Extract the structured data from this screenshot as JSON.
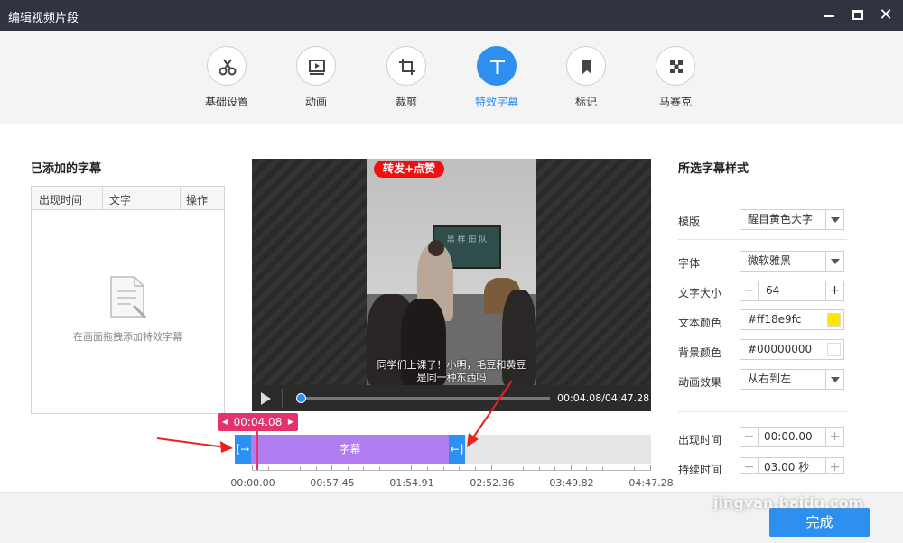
{
  "window": {
    "title": "编辑视频片段"
  },
  "toolbar": {
    "items": [
      {
        "label": "基础设置",
        "icon": "scissors-icon"
      },
      {
        "label": "动画",
        "icon": "play-frame-icon"
      },
      {
        "label": "裁剪",
        "icon": "crop-icon"
      },
      {
        "label": "特效字幕",
        "icon": "text-t-icon"
      },
      {
        "label": "标记",
        "icon": "bookmark-icon"
      },
      {
        "label": "马赛克",
        "icon": "mosaic-icon"
      }
    ],
    "active": "特效字幕"
  },
  "left_panel": {
    "title": "已添加的字幕",
    "columns": [
      "出现时间",
      "文字",
      "操作"
    ],
    "empty_text": "在画面拖拽添加特效字幕"
  },
  "video": {
    "badge": "转发+点赞",
    "board_text": "黑 样 田 队",
    "caption_line1": "同学们上课了！小明，毛豆和黄豆",
    "caption_line2": "是同一种东西吗",
    "time": "00:04.08/04:47.28",
    "progress": 0.014
  },
  "timeline": {
    "marker": "00:04.08",
    "clip_label": "字幕",
    "ticks": [
      "00:00.00",
      "00:57.45",
      "01:54.91",
      "02:52.36",
      "03:49.82",
      "04:47.28"
    ]
  },
  "right_panel": {
    "title": "所选字幕样式",
    "template_label": "模版",
    "template_value": "醒目黄色大字",
    "font_label": "字体",
    "font_value": "微软雅黑",
    "size_label": "文字大小",
    "size_value": "64",
    "text_color_label": "文本颜色",
    "text_color_value": "#ff18e9fc",
    "text_color_swatch": "#ffe600",
    "bg_color_label": "背景颜色",
    "bg_color_value": "#00000000",
    "anim_label": "动画效果",
    "anim_value": "从右到左",
    "start_label": "出现时间",
    "start_value": "00:00.00",
    "duration_label": "持续时间",
    "duration_value": "03.00 秒"
  },
  "footer": {
    "done_label": "完成",
    "watermark": "jingyan.baidu.com"
  },
  "colors": {
    "accent": "#2d8ff0",
    "marker": "#e4316f",
    "clip": "#b07ef0",
    "titlebar": "#2f3440"
  }
}
